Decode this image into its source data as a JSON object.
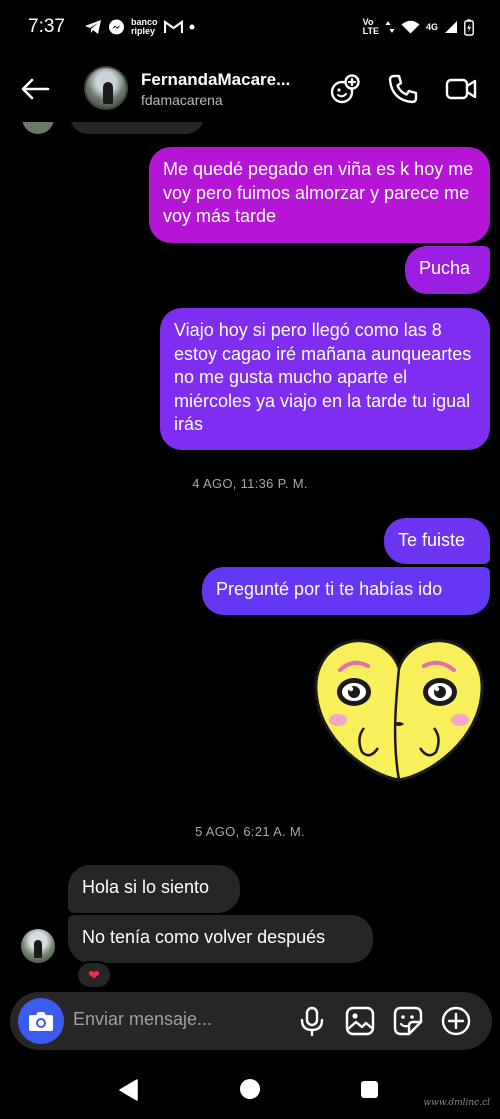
{
  "status_bar": {
    "time": "7:37",
    "notification_icons": [
      "telegram-icon",
      "messenger-icon",
      "banco-ripley-icon",
      "gmail-icon",
      "dot-icon"
    ],
    "banco_label_line1": "banco",
    "banco_label_line2": "ripley",
    "network_label_line1": "Vo",
    "network_label_line2": "LTE",
    "network_type": "4G"
  },
  "header": {
    "contact_name": "FernandaMacare...",
    "contact_handle": "fdamacarena"
  },
  "messages": [
    {
      "id": "m1",
      "direction": "sent",
      "text": "Me quedé pegado en viña es k hoy me voy pero fuimos almorzar y parece me voy más tarde"
    },
    {
      "id": "m2",
      "direction": "sent",
      "text": "Pucha"
    },
    {
      "id": "m3",
      "direction": "sent",
      "text": "Viajo hoy si pero llegó como las 8 estoy cagao iré mañana aunqueartes no me gusta mucho aparte el miércoles ya viajo en la tarde tu igual irás"
    },
    {
      "id": "m4",
      "direction": "sent",
      "text": "Te fuiste"
    },
    {
      "id": "m5",
      "direction": "sent",
      "text": "Pregunté por ti te habías ido"
    },
    {
      "id": "m6",
      "direction": "received",
      "text": "Hola si lo siento"
    },
    {
      "id": "m7",
      "direction": "received",
      "text": "No tenía como volver después",
      "reaction": "❤"
    }
  ],
  "timestamps": {
    "first": "4 AGO, 11:36 P. M.",
    "second": "5 AGO, 6:21 A. M."
  },
  "composer": {
    "placeholder": "Enviar mensaje..."
  },
  "watermark": "www.dmlinc.cl",
  "colors": {
    "background": "#000000",
    "received_bubble": "#262626",
    "sent_gradient_top": "#b515d5",
    "sent_gradient_bottom": "#6337f3",
    "camera_button": "#3c5cf0"
  }
}
